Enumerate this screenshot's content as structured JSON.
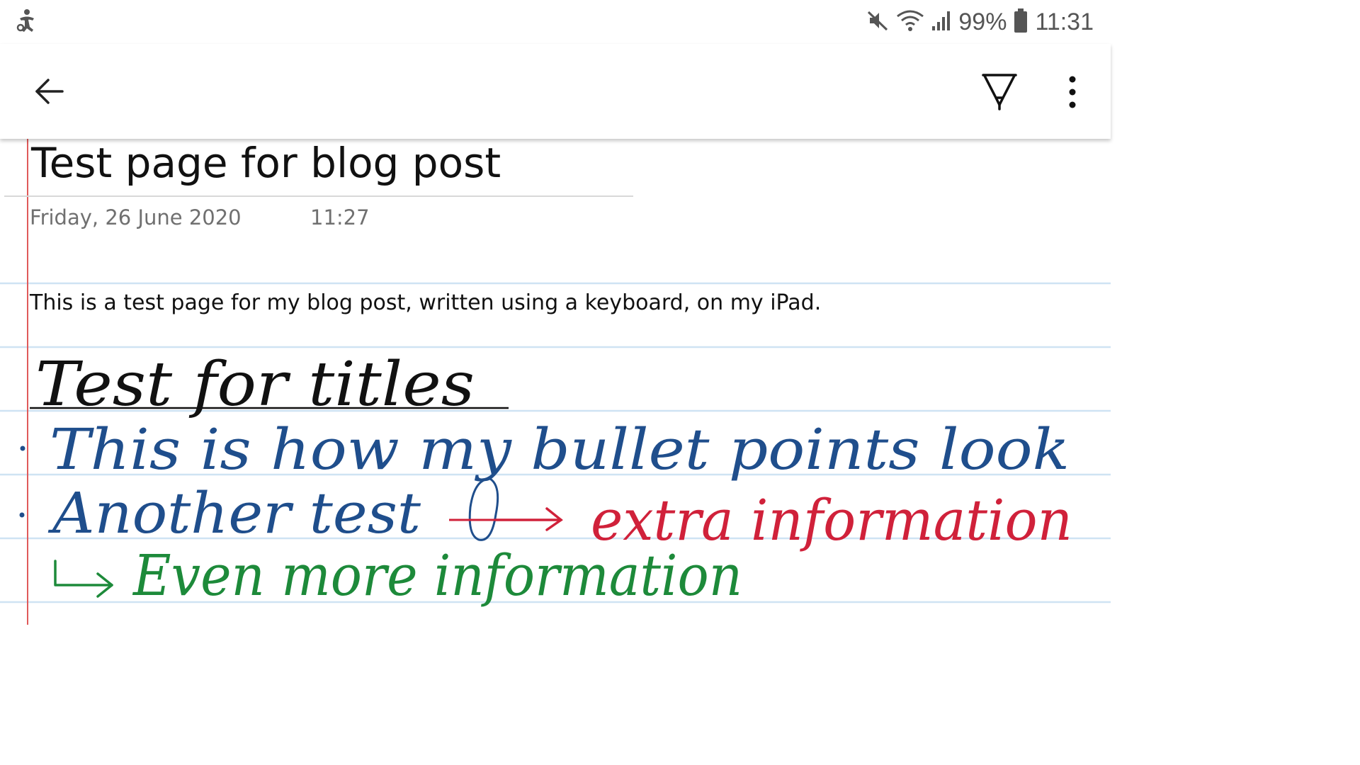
{
  "status_bar": {
    "battery": "99%",
    "time": "11:31",
    "icons": [
      "accessibility-icon",
      "mute-icon",
      "wifi-icon",
      "signal-icon",
      "battery-icon"
    ]
  },
  "app_bar": {
    "icons": [
      "back-arrow-icon",
      "pen-icon",
      "more-vert-icon"
    ]
  },
  "page": {
    "title": "Test page for blog post",
    "date": "Friday, 26 June 2020",
    "time": "11:27",
    "body": "This is a test page for my blog post, written using a keyboard, on my iPad."
  },
  "handwriting": {
    "heading": "Test for titles",
    "bullet_1": "This is how my bullet points look",
    "bullet_2": "Another test",
    "bullet_2_extra": "extra information",
    "line_3": "Even more information"
  },
  "colors": {
    "ink_black": "#111111",
    "ink_blue": "#1f4e8c",
    "ink_red": "#d0213a",
    "ink_green": "#1d8a3a",
    "rule_line": "#cfe3f3",
    "margin": "#e05a5a"
  }
}
